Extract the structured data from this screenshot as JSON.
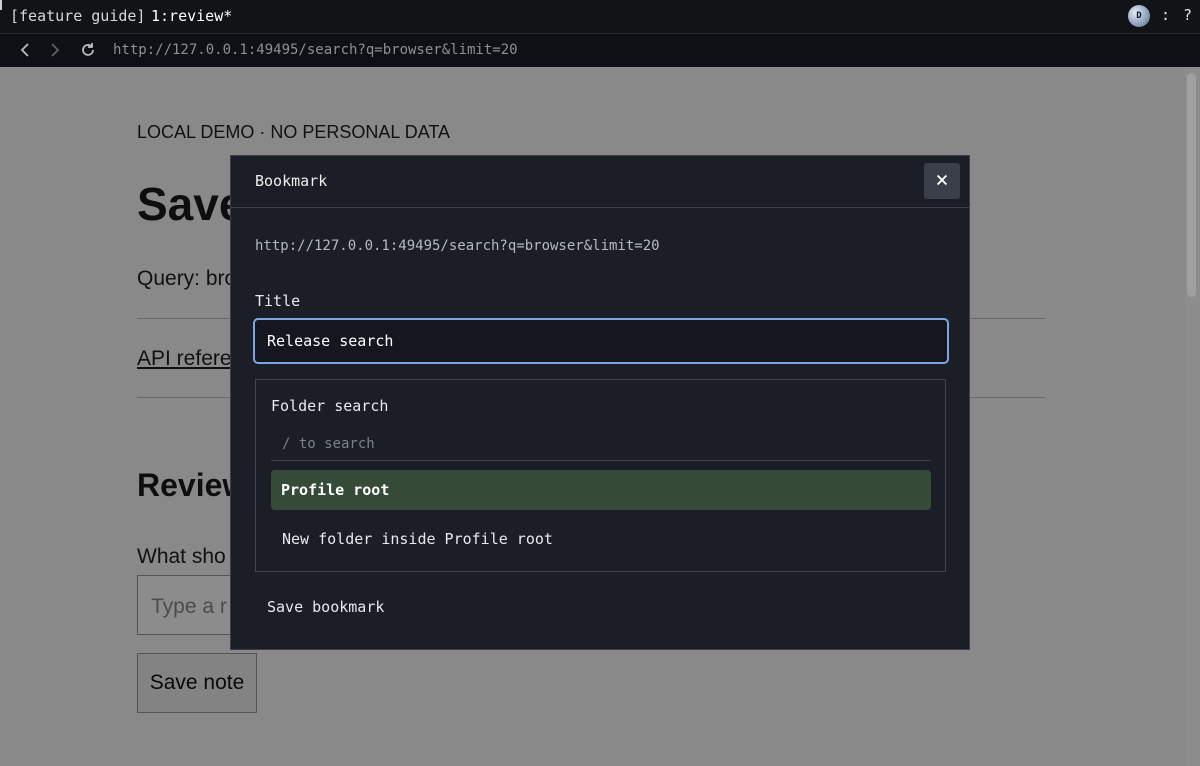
{
  "terminal": {
    "session_label": "[feature guide]",
    "active_window": "1:review*",
    "avatar_letter": "D",
    "more_label": ":",
    "help_label": "?"
  },
  "browser": {
    "url": "http://127.0.0.1:49495/search?q=browser&limit=20"
  },
  "page": {
    "eyebrow": "LOCAL DEMO · NO PERSONAL DATA",
    "heading": "Save",
    "query_text": "Query: bro",
    "api_link": "API refere",
    "review_heading": "Review",
    "question": "What sho",
    "note_placeholder": "Type a r",
    "save_note_label": "Save note"
  },
  "dialog": {
    "title": "Bookmark",
    "close_label": "×",
    "url": "http://127.0.0.1:49495/search?q=browser&limit=20",
    "title_label": "Title",
    "title_value": "Release search",
    "folder": {
      "label": "Folder search",
      "search_placeholder": "/ to search",
      "selected_option": "Profile root",
      "new_folder_option": "New folder inside Profile root"
    },
    "save_label": "Save bookmark"
  },
  "colors": {
    "selected_option_bg": "#354b37",
    "focus_ring": "#7ba6e6",
    "dialog_bg": "#1b1e26"
  }
}
